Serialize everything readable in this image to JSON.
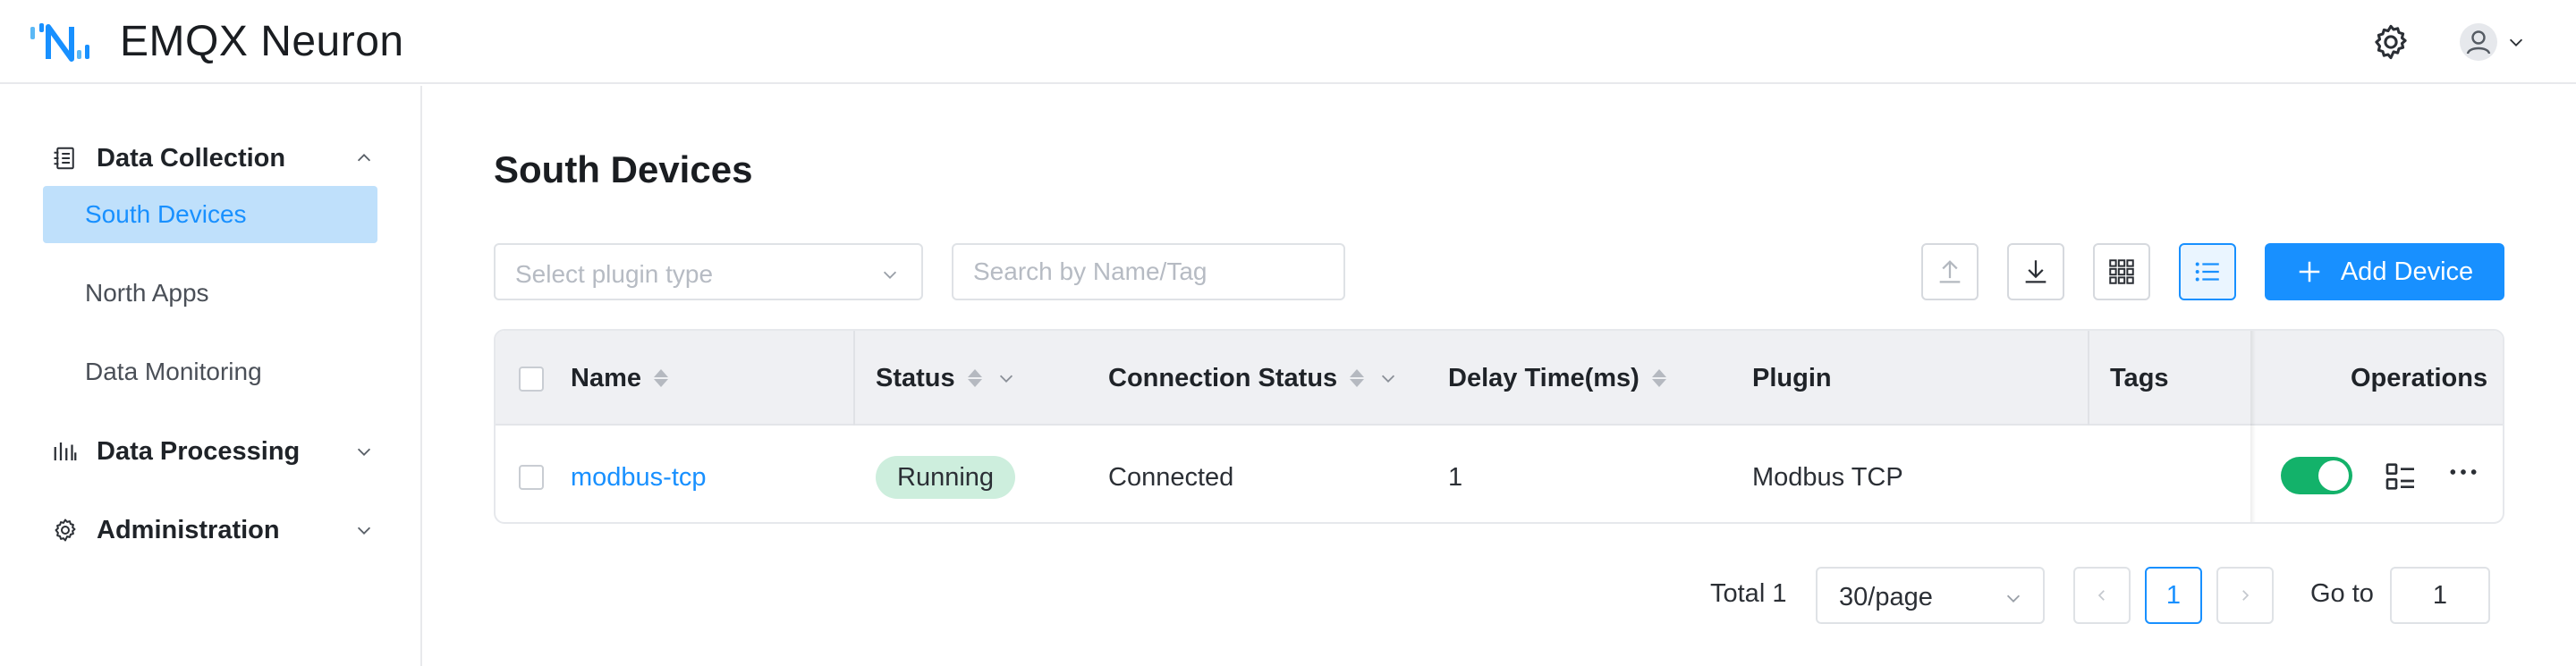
{
  "app": {
    "title": "EMQX Neuron",
    "logo_icon": "neuron-logo",
    "brand_color": "#1890ff"
  },
  "header": {
    "settings_icon": "gear-icon",
    "avatar_icon": "user-icon",
    "avatar_menu_icon": "chevron-down-icon"
  },
  "sidebar": {
    "groups": [
      {
        "label": "Data Collection",
        "icon": "data-collection-icon",
        "expanded": true,
        "items": [
          {
            "label": "South Devices",
            "active": true
          },
          {
            "label": "North Apps",
            "active": false
          },
          {
            "label": "Data Monitoring",
            "active": false
          }
        ]
      },
      {
        "label": "Data Processing",
        "icon": "bar-chart-icon",
        "expanded": false
      },
      {
        "label": "Administration",
        "icon": "gear-icon",
        "expanded": false
      }
    ]
  },
  "main": {
    "title": "South Devices",
    "filters": {
      "plugin_placeholder": "Select plugin type",
      "search_placeholder": "Search by Name/Tag"
    },
    "toolbar": {
      "import_icon": "upload-icon",
      "export_icon": "download-icon",
      "card_view_icon": "grid-icon",
      "list_view_icon": "list-icon",
      "active_view": "list",
      "add_label": "Add Device"
    },
    "table": {
      "columns": [
        "Name",
        "Status",
        "Connection Status",
        "Delay Time(ms)",
        "Plugin",
        "Tags",
        "Operations"
      ],
      "rows": [
        {
          "name": "modbus-tcp",
          "status": "Running",
          "connection_status": "Connected",
          "delay": "1",
          "plugin": "Modbus TCP",
          "tags": "",
          "enabled": true,
          "status_color": "#cdeedd",
          "toggle_color": "#13b26a"
        }
      ]
    },
    "pagination": {
      "total_label": "Total 1",
      "page_size": "30/page",
      "current_page": "1",
      "goto_label": "Go to",
      "goto_value": "1"
    }
  }
}
